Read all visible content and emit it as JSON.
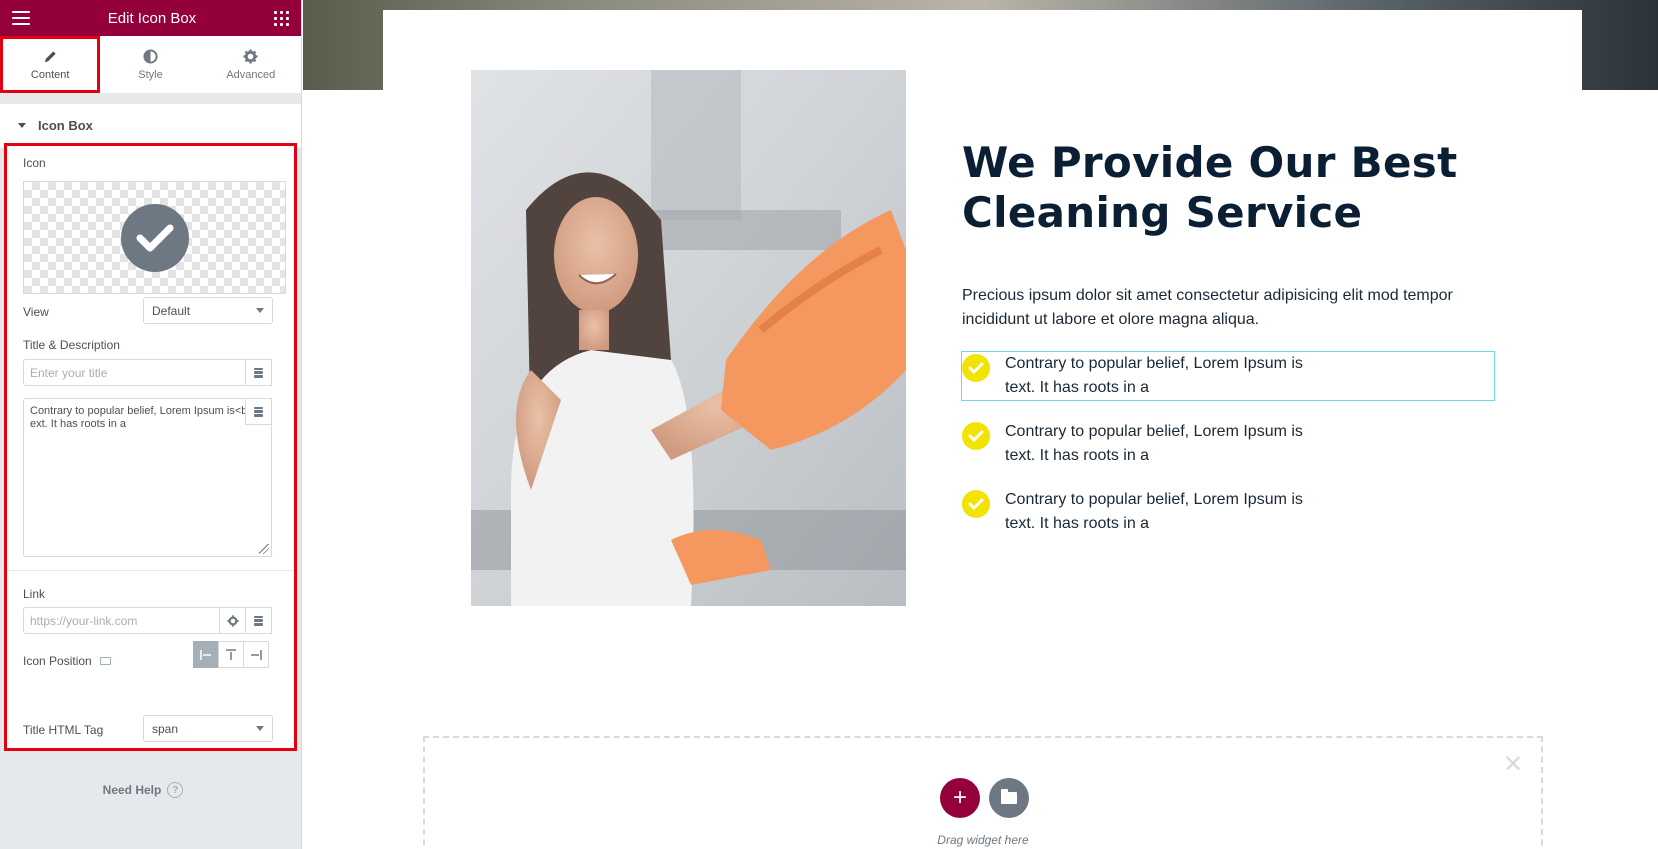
{
  "panel": {
    "header_title": "Edit Icon Box",
    "tabs": [
      {
        "label": "Content",
        "icon": "pencil-icon",
        "active": true
      },
      {
        "label": "Style",
        "icon": "half-circle-icon",
        "active": false
      },
      {
        "label": "Advanced",
        "icon": "gear-icon",
        "active": false
      }
    ],
    "section_title": "Icon Box",
    "controls": {
      "icon_label": "Icon",
      "icon_value": "check-circle-icon",
      "view_label": "View",
      "view_value": "Default",
      "title_desc_label": "Title & Description",
      "title_placeholder": "Enter your title",
      "description_value": "Contrary to popular belief, Lorem Ipsum is<br> text. It has roots in a",
      "link_label": "Link",
      "link_placeholder": "https://your-link.com",
      "icon_position_label": "Icon Position",
      "icon_position_options": [
        "Left",
        "Top",
        "Right"
      ],
      "icon_position_value": "Left",
      "title_tag_label": "Title HTML Tag",
      "title_tag_value": "span"
    },
    "need_help": "Need Help"
  },
  "canvas": {
    "heading": "We Provide Our Best Cleaning Service",
    "lead": "Precious ipsum dolor sit amet consectetur adipisicing elit mod tempor incididunt ut labore et olore magna aliqua.",
    "list": [
      "Contrary to popular belief, Lorem Ipsum is text. It has roots in a",
      "Contrary to popular belief, Lorem Ipsum is text. It has roots in a",
      "Contrary to popular belief, Lorem Ipsum is text. It has roots in a"
    ],
    "drag_text": "Drag widget here"
  },
  "colors": {
    "brand": "#93003c",
    "highlight": "#e4000f",
    "check_yellow": "#f2e300",
    "heading": "#0a1f33"
  }
}
